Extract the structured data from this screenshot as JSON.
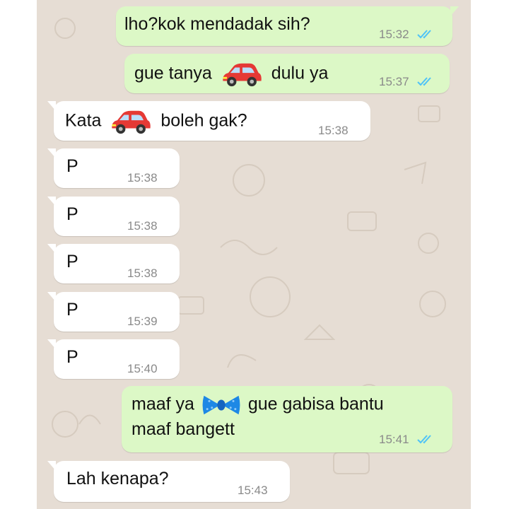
{
  "colors": {
    "chat_background": "#e6ddd4",
    "outgoing_bubble": "#dcf8c6",
    "incoming_bubble": "#ffffff",
    "read_ticks": "#4fc3f7",
    "timestamp": "#8a8a8a"
  },
  "messages": [
    {
      "direction": "outgoing",
      "text": "lho?kok mendadak sih?",
      "time": "15:32",
      "status": "read"
    },
    {
      "direction": "outgoing",
      "text_before": "gue tanya",
      "emoji": "car-emoji",
      "text_after": "dulu ya",
      "time": "15:37",
      "status": "read"
    },
    {
      "direction": "incoming",
      "text_before": "Kata",
      "emoji": "car-emoji",
      "text_after": "boleh gak?",
      "time": "15:38"
    },
    {
      "direction": "incoming",
      "text": "P",
      "time": "15:38"
    },
    {
      "direction": "incoming",
      "text": "P",
      "time": "15:38"
    },
    {
      "direction": "incoming",
      "text": "P",
      "time": "15:38"
    },
    {
      "direction": "incoming",
      "text": "P",
      "time": "15:39"
    },
    {
      "direction": "incoming",
      "text": "P",
      "time": "15:40"
    },
    {
      "direction": "outgoing",
      "text_before": "maaf ya",
      "emoji": "bow-tie-emoji",
      "text_after": "gue gabisa bantu",
      "text_line2": "maaf bangett",
      "time": "15:41",
      "status": "read"
    },
    {
      "direction": "incoming",
      "text": "Lah kenapa?",
      "time": "15:43"
    }
  ]
}
